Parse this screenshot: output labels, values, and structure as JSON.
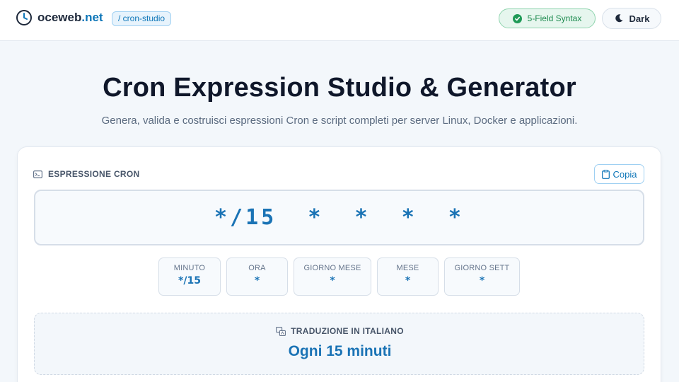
{
  "header": {
    "brand_name": "oceweb",
    "brand_tld": ".net",
    "route_badge": "/ cron-studio",
    "syntax_badge": "5-Field Syntax",
    "theme_toggle": "Dark",
    "icons": {
      "brand": "clock-icon",
      "syntax": "check-circle-icon",
      "theme": "moon-icon"
    }
  },
  "hero": {
    "title": "Cron Expression Studio & Generator",
    "subtitle": "Genera, valida e costruisci espressioni Cron e script completi per server Linux, Docker e applicazioni."
  },
  "expression": {
    "section_label": "ESPRESSIONE CRON",
    "copy_label": "Copia",
    "value": "*/15  *  *  *  *",
    "icons": {
      "section": "terminal-icon",
      "copy": "clipboard-icon"
    }
  },
  "fields": [
    {
      "label": "MINUTO",
      "value": "*/15"
    },
    {
      "label": "ORA",
      "value": "*"
    },
    {
      "label": "GIORNO MESE",
      "value": "*"
    },
    {
      "label": "MESE",
      "value": "*"
    },
    {
      "label": "GIORNO SETT",
      "value": "*"
    }
  ],
  "translation": {
    "label": "TRADUZIONE IN ITALIANO",
    "value": "Ogni 15 minuti",
    "icon": "translate-icon"
  },
  "colors": {
    "accent": "#1a73b5",
    "success": "#1f9a57",
    "background": "#f3f7fb"
  }
}
